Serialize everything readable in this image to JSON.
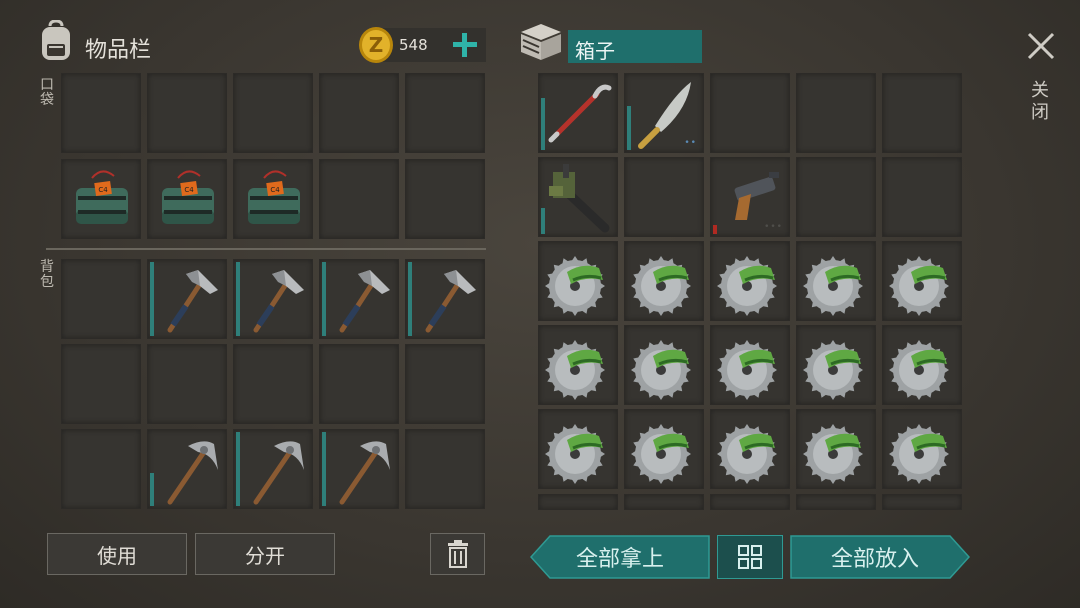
{
  "inventory": {
    "title": "物品栏",
    "currency_amount": "548",
    "pocket_label": "口袋",
    "backpack_label": "背包"
  },
  "container": {
    "title": "箱子"
  },
  "close": {
    "label": "关闭"
  },
  "actions": {
    "use": "使用",
    "split": "分开",
    "take_all": "全部拿上",
    "put_all": "全部放入"
  },
  "colors": {
    "accent": "#2f7f7a",
    "panel": "#363430",
    "teal_button": "#1f6f6c"
  },
  "pocket_slots": [
    {
      "item": null
    },
    {
      "item": null
    },
    {
      "item": null
    },
    {
      "item": null
    },
    {
      "item": null
    },
    {
      "item": "c4-explosive"
    },
    {
      "item": "c4-explosive"
    },
    {
      "item": "c4-explosive"
    },
    {
      "item": null
    },
    {
      "item": null
    }
  ],
  "backpack_slots": [
    {
      "item": null
    },
    {
      "item": "hammer",
      "durability": 1.0
    },
    {
      "item": "hammer",
      "durability": 1.0
    },
    {
      "item": "hammer",
      "durability": 1.0
    },
    {
      "item": "hammer",
      "durability": 1.0
    },
    {
      "item": null
    },
    {
      "item": null
    },
    {
      "item": null
    },
    {
      "item": null
    },
    {
      "item": null
    },
    {
      "item": null
    },
    {
      "item": "pickaxe",
      "durability": 0.45
    },
    {
      "item": "pickaxe",
      "durability": 1.0
    },
    {
      "item": "pickaxe",
      "durability": 1.0
    },
    {
      "item": null
    }
  ],
  "box_slots": [
    {
      "item": "crowbar",
      "durability": 0.7
    },
    {
      "item": "machete",
      "durability": 0.6,
      "dots": "••"
    },
    {
      "item": null
    },
    {
      "item": null
    },
    {
      "item": null
    },
    {
      "item": "sniper-part",
      "durability": 0.35
    },
    {
      "item": null
    },
    {
      "item": "flare-gun",
      "durability": 0.12,
      "dots": "•••"
    },
    {
      "item": null
    },
    {
      "item": null
    },
    {
      "item": "saw-blade"
    },
    {
      "item": "saw-blade"
    },
    {
      "item": "saw-blade"
    },
    {
      "item": "saw-blade"
    },
    {
      "item": "saw-blade"
    },
    {
      "item": "saw-blade"
    },
    {
      "item": "saw-blade"
    },
    {
      "item": "saw-blade"
    },
    {
      "item": "saw-blade"
    },
    {
      "item": "saw-blade"
    },
    {
      "item": "saw-blade"
    },
    {
      "item": "saw-blade"
    },
    {
      "item": "saw-blade"
    },
    {
      "item": "saw-blade"
    },
    {
      "item": "saw-blade"
    }
  ]
}
